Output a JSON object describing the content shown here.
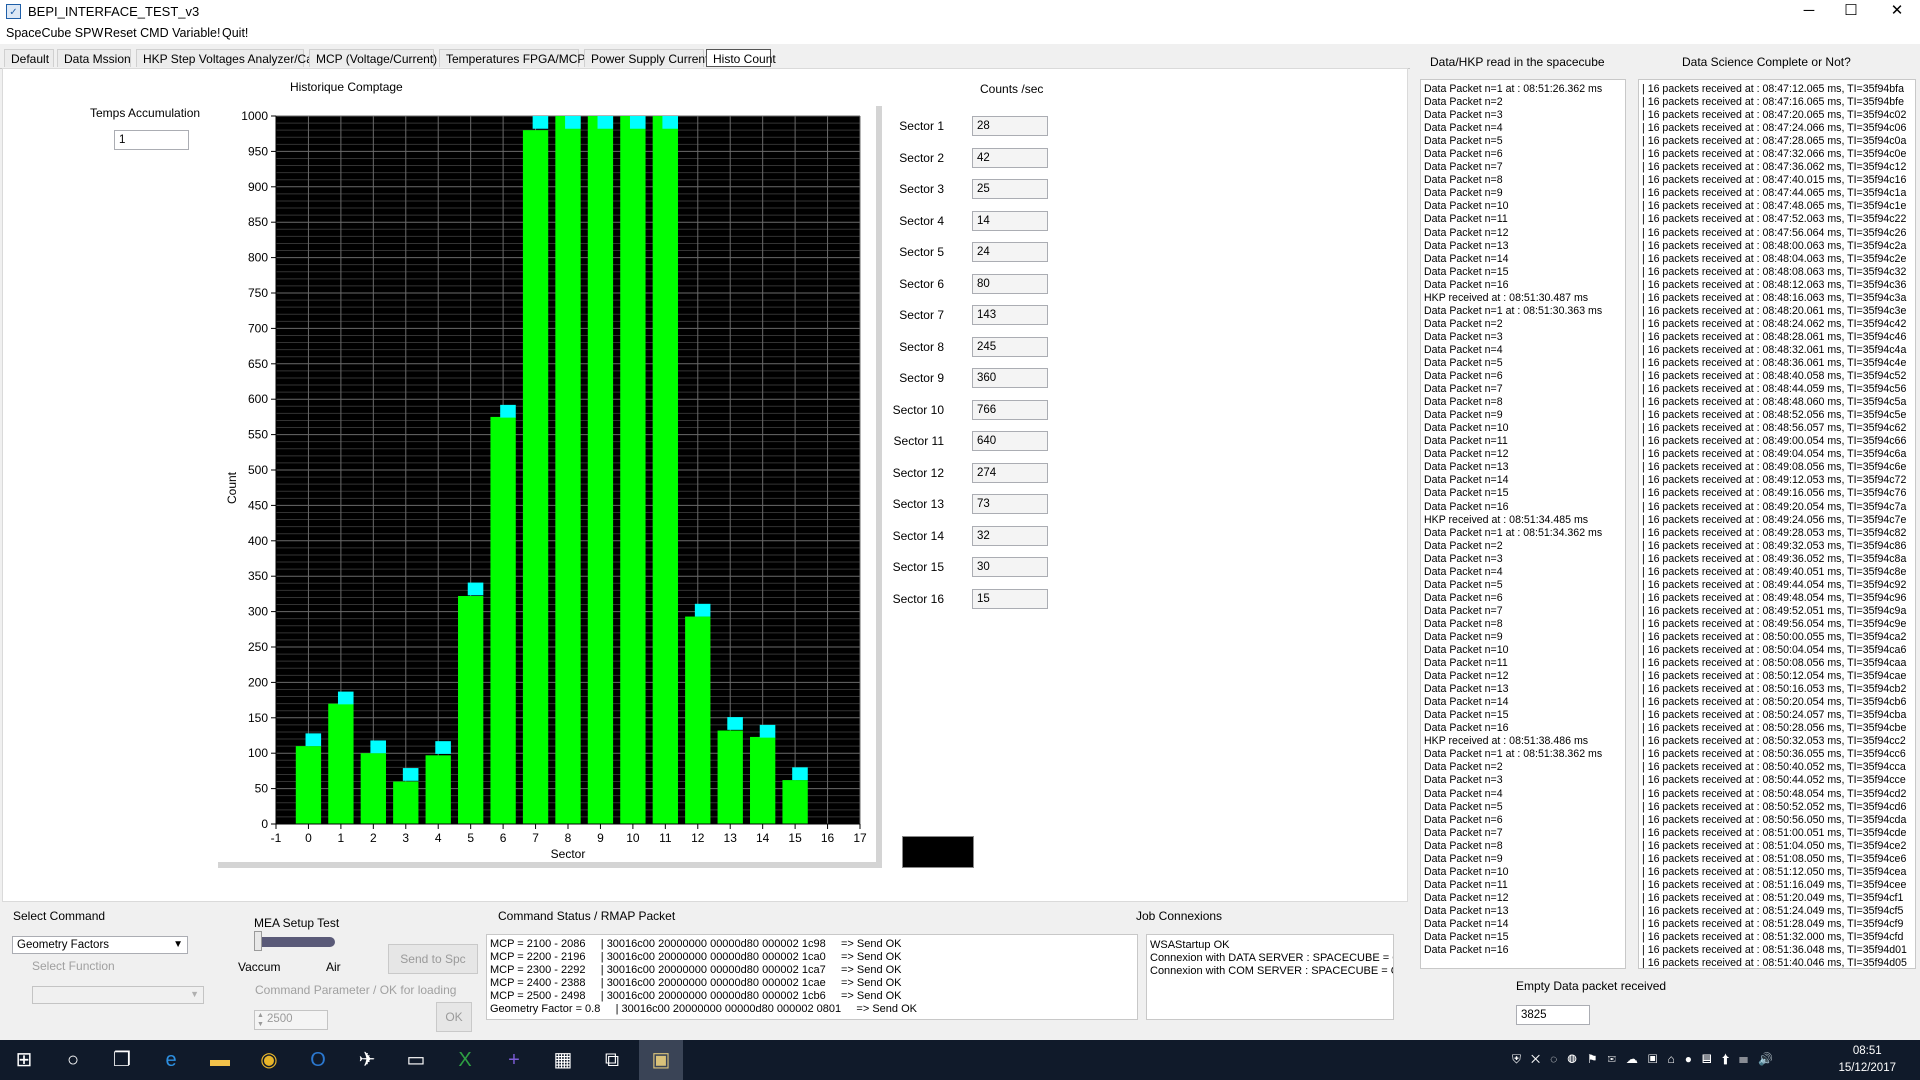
{
  "window": {
    "title": "BEPI_INTERFACE_TEST_v3",
    "minimize": "─",
    "maximize": "☐",
    "close": "✕"
  },
  "menu": [
    "SpaceCube SPW",
    "Reset CMD Variable!",
    "Quit!"
  ],
  "tabs": [
    "Default",
    "Data Mssion",
    "HKP Step Voltages Analyzer/Cal",
    "MCP (Voltage/Current)",
    "Temperatures FPGA/MCP",
    "Power Supply Current",
    "Histo Count"
  ],
  "active_tab": 6,
  "temps": {
    "label": "Temps Accumulation",
    "value": "1"
  },
  "chart_title": "Historique Comptage",
  "counts_header": "Counts /sec",
  "sectors": [
    {
      "label": "Sector 1",
      "value": "28"
    },
    {
      "label": "Sector 2",
      "value": "42"
    },
    {
      "label": "Sector 3",
      "value": "25"
    },
    {
      "label": "Sector 4",
      "value": "14"
    },
    {
      "label": "Sector 5",
      "value": "24"
    },
    {
      "label": "Sector 6",
      "value": "80"
    },
    {
      "label": "Sector 7",
      "value": "143"
    },
    {
      "label": "Sector 8",
      "value": "245"
    },
    {
      "label": "Sector 9",
      "value": "360"
    },
    {
      "label": "Sector 10",
      "value": "766"
    },
    {
      "label": "Sector 11",
      "value": "640"
    },
    {
      "label": "Sector 12",
      "value": "274"
    },
    {
      "label": "Sector 13",
      "value": "73"
    },
    {
      "label": "Sector 14",
      "value": "32"
    },
    {
      "label": "Sector 15",
      "value": "30"
    },
    {
      "label": "Sector 16",
      "value": "15"
    }
  ],
  "chart_data": {
    "type": "bar",
    "xlabel": "Sector",
    "ylabel": "Count",
    "xlim": [
      -1,
      17
    ],
    "ylim": [
      0,
      1000
    ],
    "xticks": [
      -1,
      0,
      1,
      2,
      3,
      4,
      5,
      6,
      7,
      8,
      9,
      10,
      11,
      12,
      13,
      14,
      15,
      16,
      17
    ],
    "yticks": [
      0,
      50,
      100,
      150,
      200,
      250,
      300,
      350,
      400,
      450,
      500,
      550,
      600,
      650,
      700,
      750,
      800,
      850,
      900,
      950,
      1000
    ],
    "grid": true,
    "background": "#000000",
    "bar_color": "#00ff00",
    "peak_color": "#00ffff",
    "x": [
      0,
      1,
      2,
      3,
      4,
      5,
      6,
      7,
      8,
      9,
      10,
      11,
      12,
      13,
      14,
      15
    ],
    "values": [
      110,
      170,
      100,
      60,
      97,
      322,
      575,
      980,
      1000,
      1000,
      1000,
      1000,
      293,
      132,
      123,
      62
    ],
    "peaks": [
      128,
      187,
      118,
      79,
      117,
      341,
      592,
      1000,
      1000,
      1000,
      1000,
      1000,
      311,
      151,
      140,
      80
    ]
  },
  "right_panel": {
    "left_header": "Data/HKP read in the spacecube",
    "right_header": "Data Science Complete or Not?",
    "left_log": [
      "Data Packet n=1 at : 08:51:26.362 ms",
      "Data Packet n=2",
      "Data Packet n=3",
      "Data Packet n=4",
      "Data Packet n=5",
      "Data Packet n=6",
      "Data Packet n=7",
      "Data Packet n=8",
      "Data Packet n=9",
      "Data Packet n=10",
      "Data Packet n=11",
      "Data Packet n=12",
      "Data Packet n=13",
      "Data Packet n=14",
      "Data Packet n=15",
      "Data Packet n=16",
      "HKP received at : 08:51:30.487 ms",
      "Data Packet n=1 at : 08:51:30.363 ms",
      "Data Packet n=2",
      "Data Packet n=3",
      "Data Packet n=4",
      "Data Packet n=5",
      "Data Packet n=6",
      "Data Packet n=7",
      "Data Packet n=8",
      "Data Packet n=9",
      "Data Packet n=10",
      "Data Packet n=11",
      "Data Packet n=12",
      "Data Packet n=13",
      "Data Packet n=14",
      "Data Packet n=15",
      "Data Packet n=16",
      "HKP received at : 08:51:34.485 ms",
      "Data Packet n=1 at : 08:51:34.362 ms",
      "Data Packet n=2",
      "Data Packet n=3",
      "Data Packet n=4",
      "Data Packet n=5",
      "Data Packet n=6",
      "Data Packet n=7",
      "Data Packet n=8",
      "Data Packet n=9",
      "Data Packet n=10",
      "Data Packet n=11",
      "Data Packet n=12",
      "Data Packet n=13",
      "Data Packet n=14",
      "Data Packet n=15",
      "Data Packet n=16",
      "HKP received at : 08:51:38.486 ms",
      "Data Packet n=1 at : 08:51:38.362 ms",
      "Data Packet n=2",
      "Data Packet n=3",
      "Data Packet n=4",
      "Data Packet n=5",
      "Data Packet n=6",
      "Data Packet n=7",
      "Data Packet n=8",
      "Data Packet n=9",
      "Data Packet n=10",
      "Data Packet n=11",
      "Data Packet n=12",
      "Data Packet n=13",
      "Data Packet n=14",
      "Data Packet n=15",
      "Data Packet n=16"
    ],
    "right_log": [
      "| 16 packets received at : 08:47:12.065 ms, TI=35f94bfa",
      "| 16 packets received at : 08:47:16.065 ms, TI=35f94bfe",
      "| 16 packets received at : 08:47:20.065 ms, TI=35f94c02",
      "| 16 packets received at : 08:47:24.066 ms, TI=35f94c06",
      "| 16 packets received at : 08:47:28.065 ms, TI=35f94c0a",
      "| 16 packets received at : 08:47:32.066 ms, TI=35f94c0e",
      "| 16 packets received at : 08:47:36.062 ms, TI=35f94c12",
      "| 16 packets received at : 08:47:40.015 ms, TI=35f94c16",
      "| 16 packets received at : 08:47:44.065 ms, TI=35f94c1a",
      "| 16 packets received at : 08:47:48.065 ms, TI=35f94c1e",
      "| 16 packets received at : 08:47:52.063 ms, TI=35f94c22",
      "| 16 packets received at : 08:47:56.064 ms, TI=35f94c26",
      "| 16 packets received at : 08:48:00.063 ms, TI=35f94c2a",
      "| 16 packets received at : 08:48:04.063 ms, TI=35f94c2e",
      "| 16 packets received at : 08:48:08.063 ms, TI=35f94c32",
      "| 16 packets received at : 08:48:12.063 ms, TI=35f94c36",
      "| 16 packets received at : 08:48:16.063 ms, TI=35f94c3a",
      "| 16 packets received at : 08:48:20.061 ms, TI=35f94c3e",
      "| 16 packets received at : 08:48:24.062 ms, TI=35f94c42",
      "| 16 packets received at : 08:48:28.061 ms, TI=35f94c46",
      "| 16 packets received at : 08:48:32.061 ms, TI=35f94c4a",
      "| 16 packets received at : 08:48:36.061 ms, TI=35f94c4e",
      "| 16 packets received at : 08:48:40.058 ms, TI=35f94c52",
      "| 16 packets received at : 08:48:44.059 ms, TI=35f94c56",
      "| 16 packets received at : 08:48:48.060 ms, TI=35f94c5a",
      "| 16 packets received at : 08:48:52.056 ms, TI=35f94c5e",
      "| 16 packets received at : 08:48:56.057 ms, TI=35f94c62",
      "| 16 packets received at : 08:49:00.054 ms, TI=35f94c66",
      "| 16 packets received at : 08:49:04.054 ms, TI=35f94c6a",
      "| 16 packets received at : 08:49:08.056 ms, TI=35f94c6e",
      "| 16 packets received at : 08:49:12.053 ms, TI=35f94c72",
      "| 16 packets received at : 08:49:16.056 ms, TI=35f94c76",
      "| 16 packets received at : 08:49:20.054 ms, TI=35f94c7a",
      "| 16 packets received at : 08:49:24.056 ms, TI=35f94c7e",
      "| 16 packets received at : 08:49:28.053 ms, TI=35f94c82",
      "| 16 packets received at : 08:49:32.053 ms, TI=35f94c86",
      "| 16 packets received at : 08:49:36.052 ms, TI=35f94c8a",
      "| 16 packets received at : 08:49:40.051 ms, TI=35f94c8e",
      "| 16 packets received at : 08:49:44.054 ms, TI=35f94c92",
      "| 16 packets received at : 08:49:48.054 ms, TI=35f94c96",
      "| 16 packets received at : 08:49:52.051 ms, TI=35f94c9a",
      "| 16 packets received at : 08:49:56.054 ms, TI=35f94c9e",
      "| 16 packets received at : 08:50:00.055 ms, TI=35f94ca2",
      "| 16 packets received at : 08:50:04.054 ms, TI=35f94ca6",
      "| 16 packets received at : 08:50:08.056 ms, TI=35f94caa",
      "| 16 packets received at : 08:50:12.054 ms, TI=35f94cae",
      "| 16 packets received at : 08:50:16.053 ms, TI=35f94cb2",
      "| 16 packets received at : 08:50:20.054 ms, TI=35f94cb6",
      "| 16 packets received at : 08:50:24.057 ms, TI=35f94cba",
      "| 16 packets received at : 08:50:28.056 ms, TI=35f94cbe",
      "| 16 packets received at : 08:50:32.053 ms, TI=35f94cc2",
      "| 16 packets received at : 08:50:36.055 ms, TI=35f94cc6",
      "| 16 packets received at : 08:50:40.052 ms, TI=35f94cca",
      "| 16 packets received at : 08:50:44.052 ms, TI=35f94cce",
      "| 16 packets received at : 08:50:48.054 ms, TI=35f94cd2",
      "| 16 packets received at : 08:50:52.052 ms, TI=35f94cd6",
      "| 16 packets received at : 08:50:56.050 ms, TI=35f94cda",
      "| 16 packets received at : 08:51:00.051 ms, TI=35f94cde",
      "| 16 packets received at : 08:51:04.050 ms, TI=35f94ce2",
      "| 16 packets received at : 08:51:08.050 ms, TI=35f94ce6",
      "| 16 packets received at : 08:51:12.050 ms, TI=35f94cea",
      "| 16 packets received at : 08:51:16.049 ms, TI=35f94cee",
      "| 16 packets received at : 08:51:20.049 ms, TI=35f94cf1",
      "| 16 packets received at : 08:51:24.049 ms, TI=35f94cf5",
      "| 16 packets received at : 08:51:28.049 ms, TI=35f94cf9",
      "| 16 packets received at : 08:51:32.000 ms, TI=35f94cfd",
      "| 16 packets received at : 08:51:36.048 ms, TI=35f94d01",
      "| 16 packets received at : 08:51:40.046 ms, TI=35f94d05"
    ],
    "empty_label": "Empty Data packet received",
    "empty_value": "3825"
  },
  "bottom": {
    "select_command_label": "Select Command",
    "select_command_value": "Geometry Factors",
    "select_function_label": "Select Function",
    "mea_label": "MEA Setup Test",
    "vaccum": "Vaccum",
    "air": "Air",
    "send_button": "Send to Spc",
    "cmd_param_label": "Command Parameter / OK for loading",
    "cmd_param_value": "2500",
    "ok_button": "OK",
    "cmd_status_label": "Command Status / RMAP Packet",
    "cmd_status_lines": [
      "MCP = 2100 - 2086     | 30016c00 20000000 00000d80 000002 1c98     => Send OK",
      "MCP = 2200 - 2196     | 30016c00 20000000 00000d80 000002 1ca0     => Send OK",
      "MCP = 2300 - 2292     | 30016c00 20000000 00000d80 000002 1ca7     => Send OK",
      "MCP = 2400 - 2388     | 30016c00 20000000 00000d80 000002 1cae     => Send OK",
      "MCP = 2500 - 2498     | 30016c00 20000000 00000d80 000002 1cb6     => Send OK",
      "Geometry Factor = 0.8     | 30016c00 20000000 00000d80 000002 0801     => Send OK"
    ],
    "job_label": "Job Connexions",
    "job_lines": [
      "WSAStartup OK",
      "Connexion with DATA SERVER : SPACECUBE = OK",
      "Connexion with COM SERVER : SPACECUBE = OK"
    ]
  },
  "taskbar": {
    "icons": [
      "windows-start-icon",
      "search-circle-icon",
      "task-view-icon",
      "edge-icon",
      "file-explorer-icon",
      "chrome-icon",
      "outlook-icon",
      "app-bird-icon",
      "terminal-icon",
      "excel-icon",
      "visual-studio-icon",
      "calculator-icon",
      "network-app-icon",
      "spacecube-app-icon"
    ],
    "time": "08:51",
    "date": "15/12/2017"
  }
}
